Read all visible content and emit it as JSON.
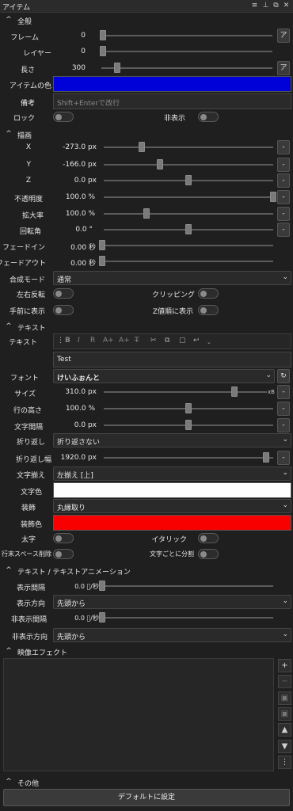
{
  "window": {
    "title": "アイテム",
    "controls": [
      "≡",
      "⊥",
      "⧉",
      "✕"
    ]
  },
  "general": {
    "header": "全般",
    "frame": {
      "label": "フレーム",
      "value": "0",
      "btn": "ア"
    },
    "layer": {
      "label": "レイヤー",
      "value": "0"
    },
    "length": {
      "label": "長さ",
      "value": "300",
      "btn": "ア"
    },
    "item_color": {
      "label": "アイテムの色",
      "color": "#0000d8"
    },
    "note": {
      "label": "備考",
      "placeholder": "Shift+Enterで改行"
    },
    "lock": {
      "label": "ロック"
    },
    "hidden": {
      "label": "非表示"
    }
  },
  "drawing": {
    "header": "描画",
    "x": {
      "label": "X",
      "value": "-273.0 px",
      "btn": "-"
    },
    "y": {
      "label": "Y",
      "value": "-166.0 px",
      "btn": "-"
    },
    "z": {
      "label": "Z",
      "value": "0.0 px",
      "btn": "-"
    },
    "opacity": {
      "label": "不透明度",
      "value": "100.0 %",
      "btn": "-"
    },
    "scale": {
      "label": "拡大率",
      "value": "100.0 %",
      "btn": "-"
    },
    "rotation": {
      "label": "回転角",
      "value": "0.0 °",
      "btn": "-"
    },
    "fadein": {
      "label": "フェードイン",
      "value": "0.00 秒"
    },
    "fadeout": {
      "label": "フェードアウト",
      "value": "0.00 秒"
    },
    "blend": {
      "label": "合成モード",
      "value": "通常"
    },
    "flip": {
      "label": "左右反転"
    },
    "clipping": {
      "label": "クリッピング"
    },
    "front": {
      "label": "手前に表示"
    },
    "zorder": {
      "label": "Z値順に表示"
    }
  },
  "text": {
    "header": "テキスト",
    "text_label": "テキスト",
    "text_value": "Test",
    "toolbar": [
      "B",
      "I",
      "R",
      "A+",
      "A+",
      "T̶",
      "✂",
      "⧉",
      "▢",
      "↩"
    ],
    "font": {
      "label": "フォント",
      "value": "けいふぉんと",
      "btn": "↻"
    },
    "size": {
      "label": "サイズ",
      "value": "310.0 px",
      "btn": "-"
    },
    "line_height": {
      "label": "行の高さ",
      "value": "100.0 %",
      "btn": "-"
    },
    "char_spacing": {
      "label": "文字間隔",
      "value": "0.0 px",
      "btn": "-"
    },
    "wrap": {
      "label": "折り返し",
      "value": "折り返さない"
    },
    "wrap_width": {
      "label": "折り返し幅",
      "value": "1920.0 px",
      "btn": "-"
    },
    "align": {
      "label": "文字揃え",
      "value": "左揃え [上]"
    },
    "color": {
      "label": "文字色",
      "color": "#ffffff"
    },
    "decoration": {
      "label": "装飾",
      "value": "丸縁取り"
    },
    "decoration_color": {
      "label": "装飾色",
      "color": "#f80000"
    },
    "bold": {
      "label": "太字"
    },
    "italic": {
      "label": "イタリック"
    },
    "trim": {
      "label": "行末スペース削除"
    },
    "split": {
      "label": "文字ごとに分割"
    }
  },
  "text_anim": {
    "header": "テキスト / テキストアニメーション",
    "show_interval": {
      "label": "表示間隔",
      "value": "0.0 ﾟ/秒"
    },
    "show_dir": {
      "label": "表示方向",
      "value": "先頭から"
    },
    "hide_interval": {
      "label": "非表示間隔",
      "value": "0.0 ﾟ/秒"
    },
    "hide_dir": {
      "label": "非表示方向",
      "value": "先頭から"
    }
  },
  "effects": {
    "header": "映像エフェクト",
    "buttons": [
      "+",
      "−",
      "▣",
      "▣",
      "▲",
      "▼",
      "⋮"
    ]
  },
  "others": {
    "header": "その他",
    "default_button": "デフォルトに設定"
  }
}
